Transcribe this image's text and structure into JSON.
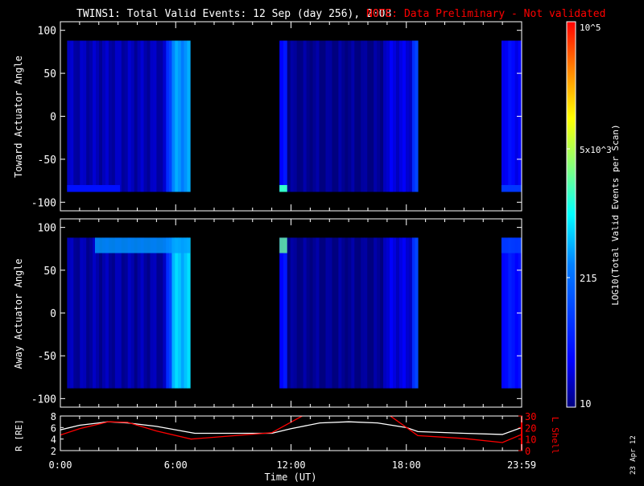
{
  "chart_data": [
    {
      "type": "heatmap",
      "title": "TWINS1: Total Valid Events: 12 Sep (day 256), 2008",
      "note": "NOTE: Data Preliminary - Not validated",
      "ylabel": "Toward Actuator Angle",
      "ylim": [
        -110,
        110
      ],
      "yticks": [
        "100",
        "50",
        "0",
        "-50",
        "-100"
      ],
      "data_angle_range": [
        -88,
        88
      ],
      "xlim_hours": [
        0,
        24
      ],
      "blocks": [
        {
          "start": 0.35,
          "end": 6.75,
          "bands": [
            [
              0.35,
              5.5,
              1.2
            ],
            [
              5.5,
              5.8,
              1.9
            ],
            [
              5.8,
              6.75,
              2.55
            ]
          ],
          "low_edge": [
            0.35,
            3.1,
            1.6
          ]
        },
        {
          "start": 11.4,
          "end": 18.6,
          "bands": [
            [
              11.4,
              11.8,
              1.6
            ],
            [
              11.8,
              16.8,
              1.05
            ],
            [
              16.8,
              18.3,
              1.35
            ],
            [
              18.3,
              18.6,
              1.9
            ]
          ],
          "low_edge": [
            11.4,
            11.8,
            3.2
          ]
        },
        {
          "start": 22.95,
          "end": 24,
          "bands": [
            [
              22.95,
              24,
              1.5
            ]
          ],
          "low_edge": [
            22.95,
            24,
            1.9
          ]
        }
      ]
    },
    {
      "type": "heatmap",
      "ylabel": "Away Actuator Angle",
      "ylim": [
        -110,
        110
      ],
      "yticks": [
        "100",
        "50",
        "0",
        "-50",
        "-100"
      ],
      "data_angle_range": [
        -88,
        88
      ],
      "xlim_hours": [
        0,
        24
      ],
      "blocks": [
        {
          "start": 0.35,
          "end": 6.75,
          "bands": [
            [
              0.35,
              5.5,
              1.15
            ],
            [
              5.5,
              5.8,
              1.9
            ],
            [
              5.8,
              6.75,
              2.75
            ]
          ],
          "high_edge": [
            1.8,
            6.75,
            2.6
          ]
        },
        {
          "start": 11.4,
          "end": 18.6,
          "bands": [
            [
              11.4,
              11.8,
              1.6
            ],
            [
              11.8,
              16.8,
              1.05
            ],
            [
              16.8,
              18.3,
              1.35
            ],
            [
              18.3,
              18.6,
              1.9
            ]
          ],
          "high_edge": [
            11.4,
            11.8,
            3.4
          ]
        },
        {
          "start": 22.95,
          "end": 24,
          "bands": [
            [
              22.95,
              24,
              1.6
            ]
          ],
          "high_edge": [
            22.95,
            24,
            2.0
          ]
        }
      ]
    },
    {
      "type": "line",
      "xlabel": "Time (UT)",
      "ylabel": "R [RE]",
      "ylabel_right": "L Shell",
      "xticks": [
        "0:00",
        "6:00",
        "12:00",
        "18:00",
        "23:59"
      ],
      "yticks_left": [
        "8",
        "6",
        "4",
        "2"
      ],
      "yticks_right": [
        "30",
        "20",
        "10",
        "0"
      ],
      "ylim_left": [
        2,
        8
      ],
      "ylim_right": [
        0,
        30
      ],
      "series": [
        {
          "name": "R",
          "color": "#ffffff",
          "x": [
            0,
            1,
            2.5,
            3.5,
            5,
            6.5,
            7,
            11,
            12,
            13.5,
            15,
            16.5,
            18,
            18.6,
            21,
            23,
            24
          ],
          "y": [
            5.6,
            6.4,
            7,
            6.8,
            6.2,
            5.3,
            5,
            5,
            5.8,
            6.8,
            7,
            6.8,
            6,
            5.3,
            5,
            4.8,
            6
          ]
        },
        {
          "name": "L Shell",
          "color": "#ff0000",
          "x": [
            0,
            1,
            2.5,
            3.5,
            5,
            6.8,
            11,
            12.8,
            17,
            18.6,
            21,
            23,
            24
          ],
          "y": [
            13.5,
            19,
            25,
            24.5,
            17,
            10,
            15.5,
            32,
            32,
            13,
            10.5,
            7,
            14
          ]
        }
      ]
    }
  ],
  "colorbar": {
    "label": "LOG10(Total Valid Events per Scan)",
    "ticks": [
      "10^5",
      "5x10^3",
      "215",
      "10"
    ],
    "range_log10": [
      1,
      5
    ]
  },
  "date_stamp": "23 Apr 12"
}
